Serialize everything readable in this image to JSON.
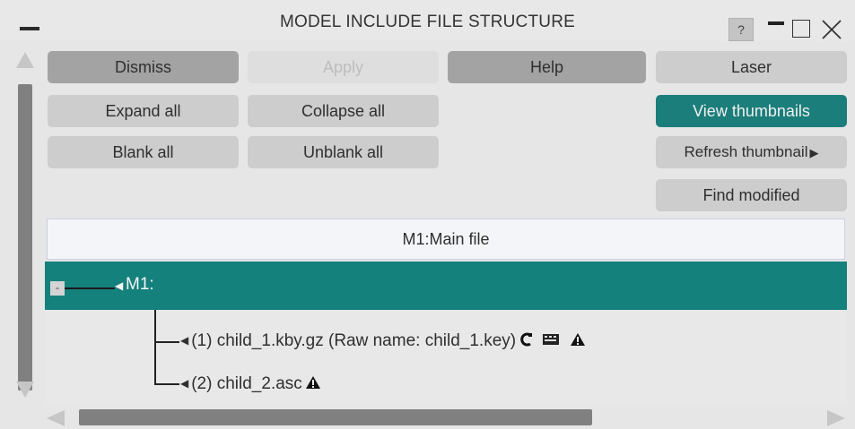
{
  "window": {
    "title": "MODEL INCLUDE FILE STRUCTURE",
    "help_label": "?"
  },
  "buttons": {
    "dismiss": "Dismiss",
    "apply": "Apply",
    "help": "Help",
    "laser": "Laser",
    "expand_all": "Expand all",
    "collapse_all": "Collapse all",
    "view_thumbnails": "View thumbnails",
    "blank_all": "Blank all",
    "unblank_all": "Unblank all",
    "refresh_thumbnail": "Refresh thumbnail",
    "find_modified": "Find modified"
  },
  "tree": {
    "header": "M1:Main file",
    "root": {
      "label": "M1:",
      "toggle": "-"
    },
    "children": [
      {
        "text": "(1) child_1.kby.gz (Raw name: child_1.key)",
        "icons": [
          "c-icon",
          "keyboard-icon",
          "warning-icon"
        ]
      },
      {
        "text": "(2) child_2.asc",
        "icons": [
          "warning-icon"
        ]
      }
    ]
  },
  "colors": {
    "selected_row": "#15817d",
    "teal_button": "#1b7e7b",
    "dark_button": "#a3a3a3",
    "light_button": "#cdcdcd"
  }
}
